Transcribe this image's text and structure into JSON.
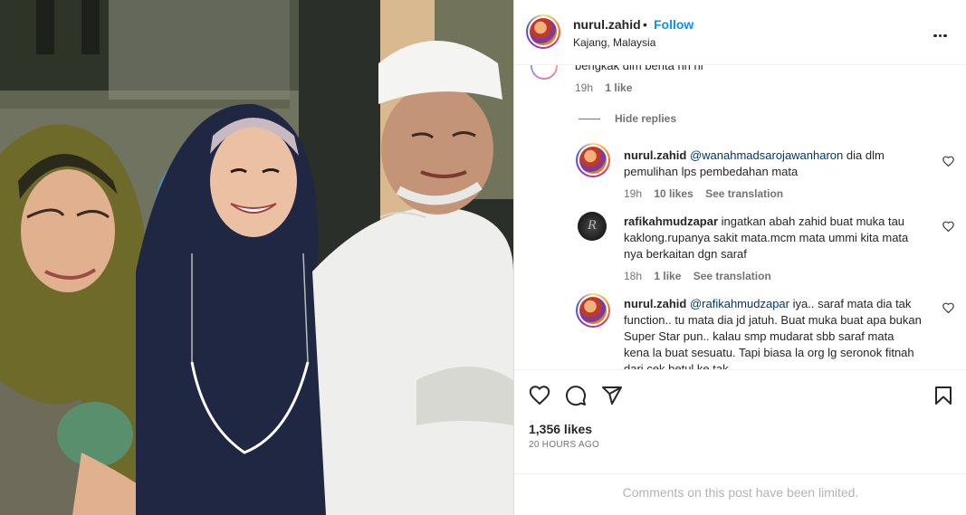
{
  "post": {
    "username": "nurul.zahid",
    "dot": "•",
    "follow_label": "Follow",
    "location": "Kajang, Malaysia",
    "more_icon": "more-horizontal-icon"
  },
  "comments": [
    {
      "text": "bengkak dlm berita hh hi",
      "time": "19h",
      "likes": "1 like"
    },
    {
      "hide_replies": "Hide replies"
    },
    {
      "username": "nurul.zahid",
      "mention": "@wanahmadsarojawanharon",
      "text": "dia dlm pemulihan lps pembedahan mata",
      "time": "19h",
      "likes": "10 likes",
      "translate": "See translation"
    },
    {
      "username": "rafikahmudzapar",
      "text": "ingatkan abah zahid buat muka tau kaklong.rupanya sakit mata.mcm mata ummi kita mata nya berkaitan dgn saraf",
      "time": "18h",
      "likes": "1 like",
      "translate": "See translation",
      "avatar_letters": "R"
    },
    {
      "username": "nurul.zahid",
      "mention": "@rafikahmudzapar",
      "text": "iya.. saraf mata dia tak function.. tu mata dia jd jatuh. Buat muka buat apa bukan Super Star pun.. kalau smp mudarat sbb saraf mata kena la buat sesuatu. Tapi biasa la org lg seronok fitnah dari cek betul ke tak"
    }
  ],
  "actions": {
    "like_icon": "heart-icon",
    "comment_icon": "comment-icon",
    "share_icon": "share-icon",
    "save_icon": "bookmark-icon",
    "likes_count": "1,356 likes",
    "time_ago": "20 HOURS AGO"
  },
  "footer": {
    "limited_text": "Comments on this post have been limited."
  },
  "colors": {
    "link": "#0095f6",
    "mention": "#00376b",
    "text": "#262626",
    "muted": "#737373"
  }
}
